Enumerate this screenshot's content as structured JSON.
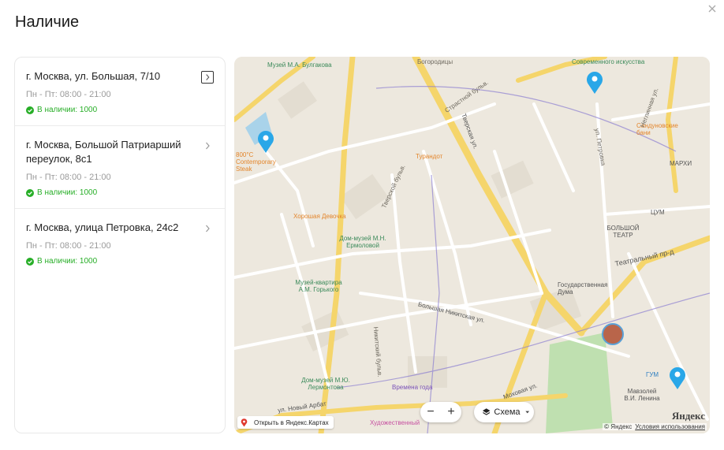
{
  "header": {
    "title": "Наличие"
  },
  "stores": [
    {
      "address": "г. Москва, ул. Большая, 7/10",
      "hours": "Пн - Пт: 08:00 - 21:00",
      "stock": "В наличии: 1000"
    },
    {
      "address": "г. Москва, Большой Патриарший переулок, 8с1",
      "hours": "Пн - Пт: 08:00 - 21:00",
      "stock": "В наличии: 1000"
    },
    {
      "address": "г. Москва, улица Петровка, 24с2",
      "hours": "Пн - Пт: 08:00 - 21:00",
      "stock": "В наличии: 1000"
    }
  ],
  "map": {
    "labels": {
      "bulgakov": "Музей М.А. Булгакова",
      "sovr": "Современного искусства",
      "sandun": "Сандуновские бани",
      "tverskaya": "Тверская ул.",
      "turandot": "Турандот",
      "strastnoy": "Страстной бульв.",
      "petrovka": "ул. Петровка",
      "neglinnaya": "Неглинная ул.",
      "marhi": "МАРХИ",
      "tsum": "ЦУМ",
      "bolshoi": "БОЛЬШОЙ ТЕАТР",
      "teatr_pr": "Театральный пр-д",
      "duma": "Государственная Дума",
      "devochka": "Хорошая Девочка",
      "ermolova": "Дом-музей М.Н. Ермоловой",
      "gorky": "Музей-квартира А.М. Горького",
      "nikitskaya": "Большая Никитская ул.",
      "mokhovaya": "Моховая ул.",
      "lermontov": "Дом-музей М.Ю. Лермонтова",
      "vremena": "Времена года",
      "novy_arbat": "ул. Новый Арбат",
      "gum": "ГУМ",
      "lenin": "Мавзолей В.И. Ленина",
      "khudozh": "Художественный",
      "bogorodits": "Богородицы",
      "steak": "800°C Contemporary Steak",
      "tverskoy_bulv": "Тверской бульв.",
      "nikitsky_bulv": "Никитский бульв."
    },
    "zoom_out": "−",
    "zoom_in": "+",
    "layer_label": "Схема",
    "open_label": "Открыть в Яндекс.Картах",
    "copyright": "© Яндекс",
    "terms": "Условия использования",
    "logo": "Яндекс"
  }
}
